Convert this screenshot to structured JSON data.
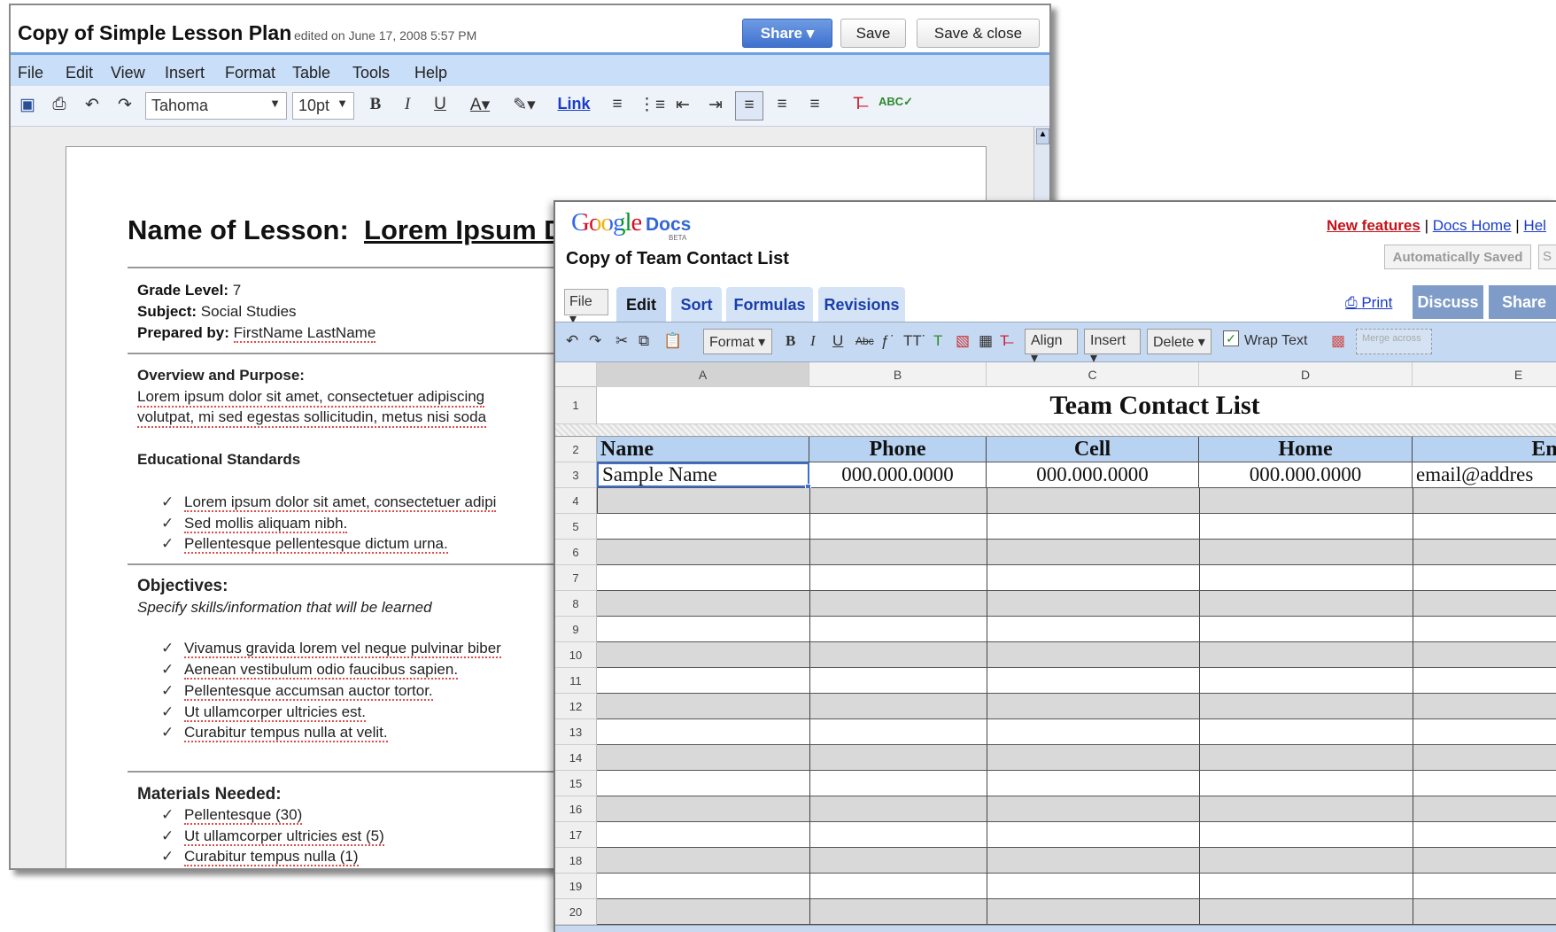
{
  "doc": {
    "title": "Copy of Simple Lesson Plan",
    "edited": "edited on June 17, 2008 5:57 PM",
    "share_label": "Share ▾",
    "save_label": "Save",
    "save_close_label": "Save & close",
    "menu": [
      "File",
      "Edit",
      "View",
      "Insert",
      "Format",
      "Table",
      "Tools",
      "Help"
    ],
    "font": "Tahoma",
    "size": "10pt",
    "link_label": "Link",
    "heading_label": "Name of Lesson:",
    "heading_value": "Lorem Ipsum Do",
    "grade_label": "Grade Level:",
    "grade_value": "7",
    "subject_label": "Subject:",
    "subject_value": "Social Studies",
    "prepared_label": "Prepared by:",
    "prepared_value": "FirstName LastName",
    "overview_label": "Overview and Purpose:",
    "overview_line1": "Lorem ipsum dolor sit amet, consectetuer adipiscing",
    "overview_line2": "volutpat, mi sed egestas sollicitudin, metus nisi soda",
    "standards_label": "Educational Standards",
    "standards": [
      "Lorem ipsum dolor sit amet, consectetuer adipi",
      "Sed mollis aliquam nibh.",
      "Pellentesque pellentesque dictum urna."
    ],
    "objectives_label": "Objectives:",
    "objectives_sub": "Specify skills/information that will be learned",
    "objectives": [
      "Vivamus gravida lorem vel neque pulvinar biber",
      "Aenean vestibulum odio faucibus sapien.",
      "Pellentesque accumsan auctor tortor.",
      "Ut ullamcorper ultricies est.",
      "Curabitur tempus nulla at velit."
    ],
    "materials_label": "Materials Needed:",
    "materials": [
      "Pellentesque (30)",
      "Ut ullamcorper ultricies est (5)",
      "Curabitur tempus nulla (1)"
    ]
  },
  "sheet": {
    "logo_google": "Google",
    "logo_docs": "Docs",
    "logo_beta": "BETA",
    "link_new": "New features",
    "link_home": "Docs Home",
    "link_help": "Hel",
    "sep": "|",
    "title": "Copy of Team Contact List",
    "autosave": "Automatically Saved",
    "autosave2": "S",
    "file_menu": "File ▾",
    "tabs": [
      "Edit",
      "Sort",
      "Formulas",
      "Revisions"
    ],
    "print": "Print",
    "discuss": "Discuss",
    "share": "Share",
    "format_btn": "Format ▾",
    "align_btn": "Align ▾",
    "insert_btn": "Insert ▾",
    "delete_btn": "Delete ▾",
    "wrap_text": "Wrap Text",
    "merge_across": "Merge across",
    "columns": [
      "A",
      "B",
      "C",
      "D",
      "E"
    ],
    "sheet_heading": "Team Contact List",
    "headers": [
      "Name",
      "Phone",
      "Cell",
      "Home",
      "Emai"
    ],
    "sample_row": [
      "Sample Name",
      "000.000.0000",
      "000.000.0000",
      "000.000.0000",
      "email@addres"
    ],
    "row_numbers": [
      "1",
      "2",
      "3",
      "4",
      "5",
      "6",
      "7",
      "8",
      "9",
      "10",
      "11",
      "12",
      "13",
      "14",
      "15",
      "16",
      "17",
      "18",
      "19",
      "20"
    ]
  }
}
